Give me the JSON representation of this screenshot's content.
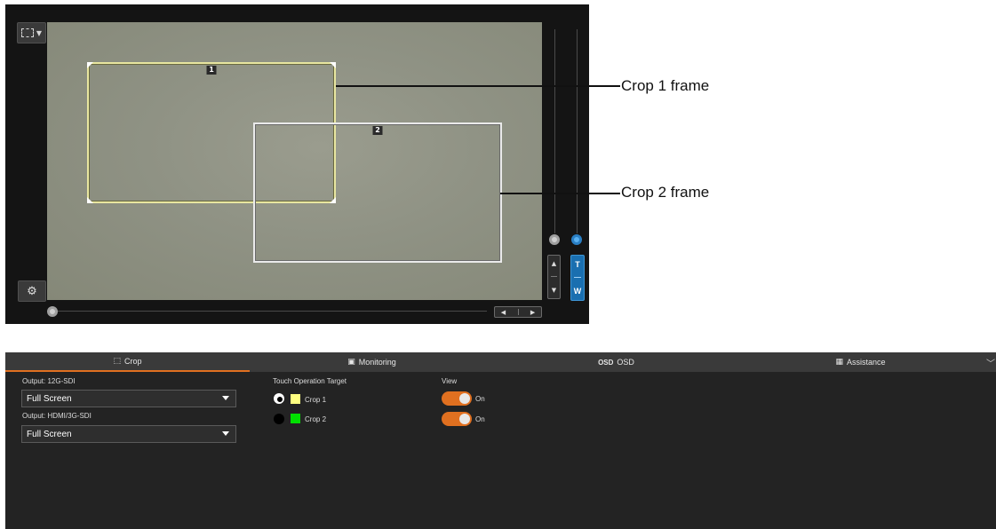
{
  "callouts": {
    "crop1": "Crop 1 frame",
    "crop2": "Crop 2 frame"
  },
  "viewer": {
    "crop1_number": "1",
    "crop2_number": "2",
    "zoom_tele": "T",
    "zoom_wide": "W",
    "icons": [
      "area-select-icon",
      "settings-icon",
      "up-arrow-icon",
      "down-arrow-icon",
      "left-arrow-icon",
      "right-arrow-icon"
    ]
  },
  "tabs": [
    {
      "label": "Crop",
      "icon": "crop-icon",
      "active": true
    },
    {
      "label": "Monitoring",
      "icon": "monitoring-icon",
      "active": false
    },
    {
      "label": "OSD",
      "icon_text": "OSD",
      "active": false
    },
    {
      "label": "Assistance",
      "icon": "assistance-icon",
      "active": false
    }
  ],
  "output_12g": {
    "label": "Output: 12G-SDI",
    "value": "Full Screen"
  },
  "output_hdmi": {
    "label": "Output: HDMI/3G-SDI",
    "value": "Full Screen"
  },
  "touch_target": {
    "label": "Touch Operation Target",
    "items": [
      {
        "label": "Crop 1",
        "color": "#ffff80",
        "selected": true
      },
      {
        "label": "Crop 2",
        "color": "#00e000",
        "selected": false
      }
    ]
  },
  "view": {
    "label": "View",
    "items": [
      {
        "state": "On"
      },
      {
        "state": "On"
      }
    ]
  },
  "colors": {
    "accent": "#e07020",
    "zoom_blue": "#1a6fb0"
  }
}
